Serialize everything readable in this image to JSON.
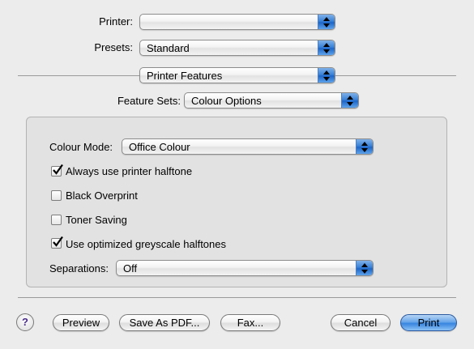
{
  "printer": {
    "label": "Printer:",
    "value": ""
  },
  "presets": {
    "label": "Presets:",
    "value": "Standard"
  },
  "pane_selector": {
    "value": "Printer Features"
  },
  "feature_sets": {
    "label": "Feature Sets:",
    "value": "Colour Options"
  },
  "options": {
    "colour_mode": {
      "label": "Colour Mode:",
      "value": "Office Colour"
    },
    "checkboxes": [
      {
        "label": "Always use printer halftone",
        "checked": true
      },
      {
        "label": "Black Overprint",
        "checked": false
      },
      {
        "label": "Toner Saving",
        "checked": false
      },
      {
        "label": "Use optimized greyscale halftones",
        "checked": true
      }
    ],
    "separations": {
      "label": "Separations:",
      "value": "Off"
    }
  },
  "buttons": {
    "help": "?",
    "preview": "Preview",
    "save_as_pdf": "Save As PDF...",
    "fax": "Fax...",
    "cancel": "Cancel",
    "print": "Print"
  }
}
